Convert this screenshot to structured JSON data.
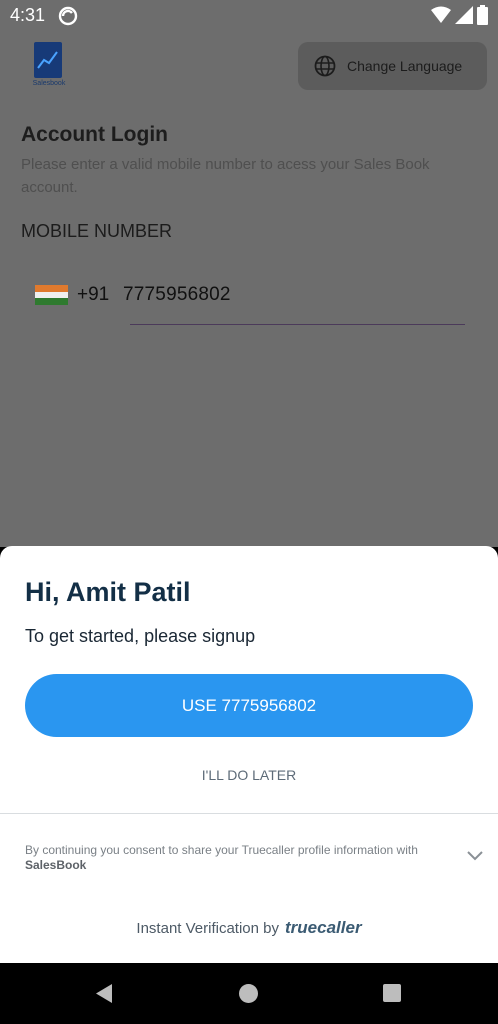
{
  "status": {
    "time": "4:31"
  },
  "logo": {
    "text": "Salesbook"
  },
  "header": {
    "change_language": "Change Language"
  },
  "login": {
    "title": "Account Login",
    "subtitle": "Please enter a valid mobile number to acess your Sales Book account.",
    "mobile_label": "MOBILE NUMBER",
    "country_code": "+91",
    "phone": "7775956802"
  },
  "sheet": {
    "greeting": "Hi, Amit Patil",
    "get_started": "To get started, please signup",
    "use_button": "USE 7775956802",
    "later": "I'LL DO LATER",
    "consent_prefix": "By continuing you consent to share your Truecaller profile information with",
    "consent_app": "SalesBook",
    "verification": "Instant Verification by",
    "truecaller": "truecaller"
  },
  "colors": {
    "accent": "#2a96f0",
    "heading": "#132f46",
    "overlay": "#6d6d6d"
  },
  "icons": [
    "sync-icon",
    "wifi-icon",
    "signal-icon",
    "battery-icon",
    "globe-icon",
    "chevron-down-icon",
    "back-icon",
    "home-icon",
    "recents-icon"
  ]
}
